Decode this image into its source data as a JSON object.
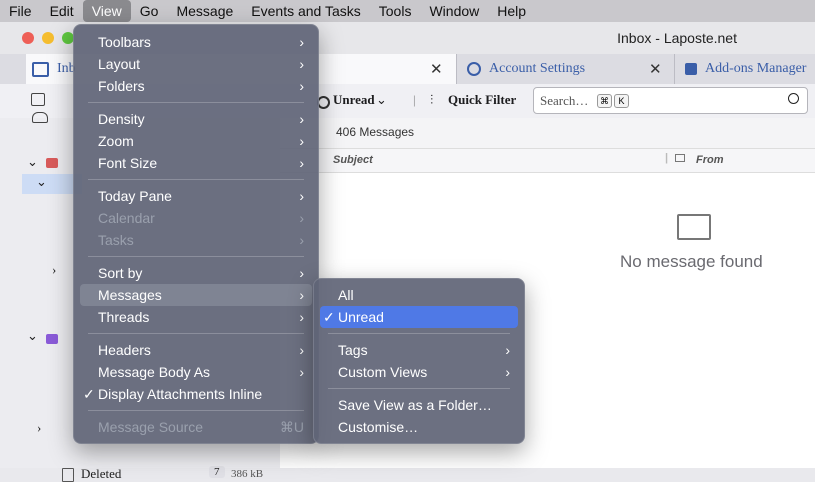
{
  "menubar": [
    "File",
    "Edit",
    "View",
    "Go",
    "Message",
    "Events and Tasks",
    "Tools",
    "Window",
    "Help"
  ],
  "window": {
    "title": "Inbox - Laposte.net"
  },
  "tabs": {
    "inbox": "Inb",
    "account_settings": "Account Settings",
    "addons": "Add-ons Manager",
    "close_glyph": "✕"
  },
  "toolbar": {
    "unread_filter": "Unread",
    "quick_filter": "Quick Filter",
    "search_placeholder": "Search…",
    "kbd1": "⌘",
    "kbd2": "K"
  },
  "message_list": {
    "count": "406 Messages",
    "col_subject": "Subject",
    "col_from": "From",
    "empty": "No message found"
  },
  "sidebar": {
    "deleted_label": "Deleted",
    "deleted_count": "7",
    "deleted_size": "386 kB"
  },
  "view_menu": [
    {
      "label": "Toolbars",
      "submenu": true
    },
    {
      "label": "Layout",
      "submenu": true
    },
    {
      "label": "Folders",
      "submenu": true
    },
    {
      "sep": true
    },
    {
      "label": "Density",
      "submenu": true
    },
    {
      "label": "Zoom",
      "submenu": true
    },
    {
      "label": "Font Size",
      "submenu": true
    },
    {
      "sep": true
    },
    {
      "label": "Today Pane",
      "submenu": true
    },
    {
      "label": "Calendar",
      "submenu": true,
      "disabled": true
    },
    {
      "label": "Tasks",
      "submenu": true,
      "disabled": true
    },
    {
      "sep": true
    },
    {
      "label": "Sort by",
      "submenu": true
    },
    {
      "label": "Messages",
      "submenu": true,
      "highlighted": true
    },
    {
      "label": "Threads",
      "submenu": true
    },
    {
      "sep": true
    },
    {
      "label": "Headers",
      "submenu": true
    },
    {
      "label": "Message Body As",
      "submenu": true
    },
    {
      "label": "Display Attachments Inline",
      "checked": true
    },
    {
      "sep": true
    },
    {
      "label": "Message Source",
      "shortcut": "⌘U",
      "disabled": true
    }
  ],
  "messages_submenu": [
    {
      "label": "All"
    },
    {
      "label": "Unread",
      "checked": true,
      "selected": true
    },
    {
      "sep": true
    },
    {
      "label": "Tags",
      "submenu": true
    },
    {
      "label": "Custom Views",
      "submenu": true
    },
    {
      "sep": true
    },
    {
      "label": "Save View as a Folder…"
    },
    {
      "label": "Customise…"
    }
  ],
  "colors": {
    "accent": "#4f79e6",
    "menu_bg": "#606476"
  }
}
